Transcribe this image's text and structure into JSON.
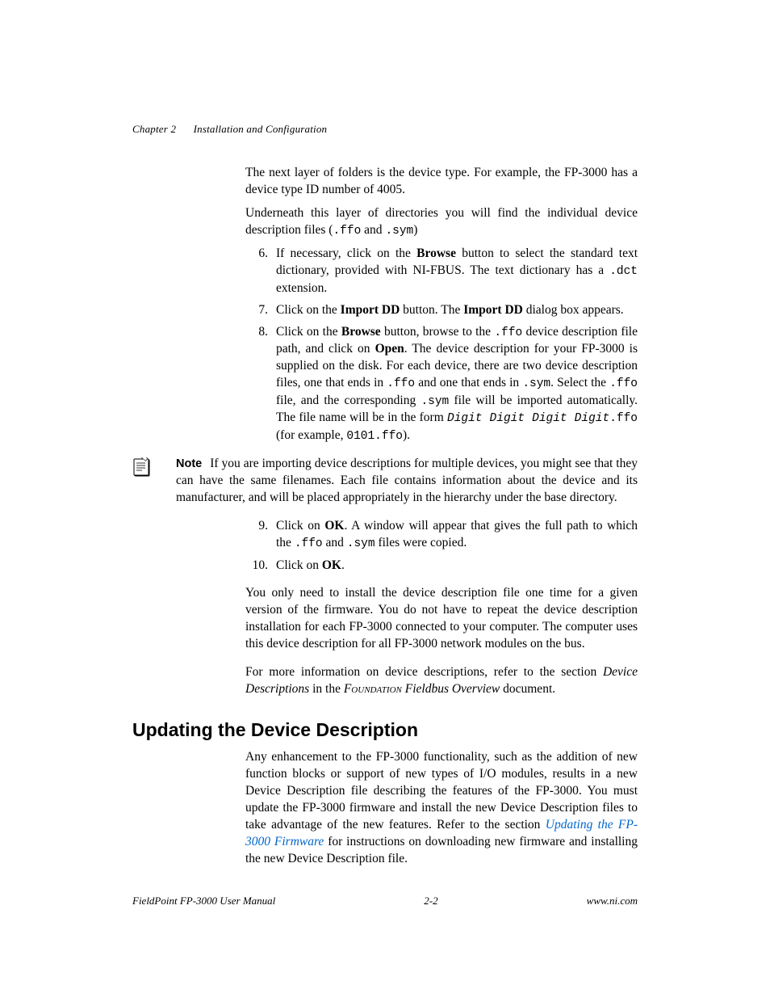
{
  "header": {
    "chapter_label": "Chapter 2",
    "chapter_title": "Installation and Configuration"
  },
  "intro": {
    "p1_a": "The next layer of folders is the device type. For example, the FP-3000 has a device type ID number of 4005.",
    "p2_a": "Underneath this layer of directories you will find the individual device description files (",
    "p2_code1": ".ffo",
    "p2_mid": " and ",
    "p2_code2": ".sym",
    "p2_end": ")"
  },
  "steps": {
    "s6_a": "If necessary, click on the ",
    "s6_b": "Browse",
    "s6_c": " button to select the standard text dictionary, provided with NI-FBUS. The text dictionary has a ",
    "s6_code": ".dct",
    "s6_d": " extension.",
    "s7_a": "Click on the ",
    "s7_b": "Import DD",
    "s7_c": " button. The ",
    "s7_d": "Import DD",
    "s7_e": " dialog box appears.",
    "s8_a": "Click on the ",
    "s8_b": "Browse",
    "s8_c": " button, browse to the ",
    "s8_code1": ".ffo",
    "s8_d": " device description file path, and click on ",
    "s8_e": "Open",
    "s8_f": ". The device description for your FP-3000 is supplied on the disk. For each device, there are two device description files, one that ends in ",
    "s8_code2": ".ffo",
    "s8_g": " and one that ends in ",
    "s8_code3": ".sym",
    "s8_h": ". Select the ",
    "s8_code4": ".ffo",
    "s8_i": " file, and the corresponding ",
    "s8_code5": ".sym",
    "s8_j": " file will be imported automatically. The file name will be in the form ",
    "s8_code_it": "Digit Digit Digit Digit",
    "s8_code6": ".ffo",
    "s8_k": " (for example, ",
    "s8_code7": "0101.ffo",
    "s8_l": ").",
    "s9_a": "Click on ",
    "s9_b": "OK",
    "s9_c": ". A window will appear that gives the full path to which the ",
    "s9_code1": ".ffo",
    "s9_d": " and ",
    "s9_code2": ".sym",
    "s9_e": " files were copied.",
    "s10_a": "Click on ",
    "s10_b": "OK",
    "s10_c": "."
  },
  "note": {
    "label": "Note",
    "text": "If you are importing device descriptions for multiple devices, you might see that they can have the same filenames. Each file contains information about the device and its manufacturer, and will be placed appropriately in the hierarchy under the base directory."
  },
  "after": {
    "p1": "You only need to install the device description file one time for a given version of the firmware. You do not have to repeat the device description installation for each FP-3000 connected to your computer. The computer uses this device description for all FP-3000 network modules on the bus.",
    "p2_a": "For more information on device descriptions, refer to the section ",
    "p2_i1": "Device Descriptions",
    "p2_b": " in the ",
    "p2_sc": "Foundation",
    "p2_i2": " Fieldbus Overview",
    "p2_c": " document."
  },
  "section": {
    "heading": "Updating the Device Description",
    "p_a": "Any enhancement to the FP-3000 functionality, such as the addition of new function blocks or support of new types of I/O modules, results in a new Device Description file describing the features of the FP-3000. You must update the FP-3000 firmware and install the new Device Description files to take advantage of the new features. Refer to the section ",
    "p_link": "Updating the FP-3000 Firmware",
    "p_b": " for instructions on downloading new firmware and installing the new Device Description file."
  },
  "footer": {
    "left": "FieldPoint FP-3000 User Manual",
    "center": "2-2",
    "right": "www.ni.com"
  },
  "nums": {
    "n6": "6.",
    "n7": "7.",
    "n8": "8.",
    "n9": "9.",
    "n10": "10."
  }
}
